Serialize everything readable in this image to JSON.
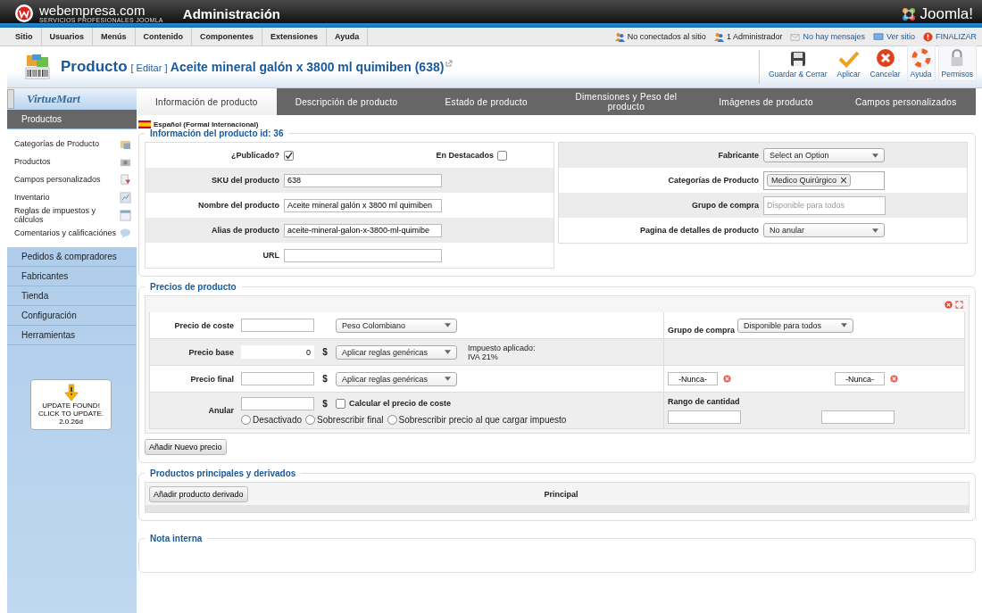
{
  "header": {
    "brand": "webempresa.com",
    "brand_tagline": "SERVICIOS PROFESIONALES JOOMLA",
    "title": "Administración",
    "cms_logo": "Joomla!"
  },
  "menu": [
    "Sitio",
    "Usuarios",
    "Menús",
    "Contenido",
    "Componentes",
    "Extensiones",
    "Ayuda"
  ],
  "status_links": [
    {
      "kind": "users",
      "label": "No conectados al sitio"
    },
    {
      "kind": "users",
      "label": "1 Administrador"
    },
    {
      "kind": "mail",
      "label": "No hay mensajes"
    },
    {
      "kind": "screen",
      "label": "Ver sitio"
    },
    {
      "kind": "power",
      "label": "FINALIZAR"
    }
  ],
  "page_title": {
    "section": "Producto",
    "action": "[ Editar ]",
    "name": "Aceite mineral galón x 3800 ml quimiben (638)"
  },
  "toolbar": [
    {
      "kind": "save",
      "label": "Guardar & Cerrar"
    },
    {
      "kind": "apply",
      "label": "Aplicar"
    },
    {
      "kind": "cancel",
      "label": "Cancelar"
    },
    {
      "kind": "help",
      "label": "Ayuda"
    },
    {
      "kind": "lock",
      "label": "Permisos"
    }
  ],
  "sidebar": {
    "logo": "VirtueMart",
    "active_group": "Productos",
    "items": [
      {
        "label": "Categorías de Producto",
        "kind": "folder"
      },
      {
        "label": "Productos",
        "kind": "camera"
      },
      {
        "label": "Campos personalizados",
        "kind": "doc"
      },
      {
        "label": "Inventario",
        "kind": "chart"
      },
      {
        "label": "Reglas de impuestos y cálculos",
        "kind": "calc"
      },
      {
        "label": "Comentarios y calificaciónes",
        "kind": "bubble"
      }
    ],
    "groups": [
      "Pedidos & compradores",
      "Fabricantes",
      "Tienda",
      "Configuración",
      "Herramientas"
    ],
    "update": {
      "lines": [
        "UPDATE FOUND!",
        "CLICK TO UPDATE.",
        "2.0.26d"
      ]
    }
  },
  "tabs": [
    {
      "label": "Información de producto",
      "selected": true
    },
    {
      "label": "Descripción de producto",
      "selected": false
    },
    {
      "label": "Estado de producto",
      "selected": false
    },
    {
      "label": "Dimensiones y Peso del producto",
      "selected": false
    },
    {
      "label": "Imágenes de producto",
      "selected": false
    },
    {
      "label": "Campos personalizados",
      "selected": false
    }
  ],
  "language": "Español (Formal Internacional)",
  "info": {
    "legend": "Información del producto id: 36",
    "published": {
      "label": "¿Publicado?",
      "checked": true
    },
    "featured": {
      "label": "En Destacados",
      "checked": false
    },
    "left_fields": [
      {
        "label": "SKU del producto",
        "value": "638"
      },
      {
        "label": "Nombre del producto",
        "value": "Aceite mineral galón x 3800 ml quimiben"
      },
      {
        "label": "Alias de producto",
        "value": "aceite-mineral-galon-x-3800-ml-quimibe"
      },
      {
        "label": "URL"
      }
    ],
    "right_fields": [
      {
        "kind": "select",
        "label": "Fabricante",
        "value": "Select an Option"
      },
      {
        "kind": "tags",
        "label": "Categorías de Producto",
        "value": "Medico Quirúrgico"
      },
      {
        "kind": "input",
        "label": "Grupo de compra",
        "placeholder": "Disponible para todos"
      },
      {
        "kind": "select",
        "label": "Pagina de detalles de producto",
        "value": "No anular"
      }
    ]
  },
  "prices": {
    "legend": "Precios de producto",
    "cost": {
      "label": "Precio de coste",
      "currency": "Peso Colombiano"
    },
    "shopper_group": {
      "label": "Grupo de compra",
      "value": "Disponible para todos"
    },
    "base": {
      "label": "Precio base",
      "value": "0",
      "unit": "$",
      "rule": "Aplicar reglas genéricas",
      "tax_label": "Impuesto aplicado:",
      "tax_value": "IVA 21%"
    },
    "final": {
      "label": "Precio final",
      "unit": "$",
      "rule": "Aplicar reglas genéricas",
      "date_from": "-Nunca-",
      "date_to": "-Nunca-"
    },
    "override": {
      "label": "Anular",
      "unit": "$",
      "calc_label": "Calcular el precio de coste",
      "calc_checked": false,
      "options": [
        {
          "label": "Desactivado",
          "selected": false
        },
        {
          "label": "Sobrescribir final",
          "selected": false
        },
        {
          "label": "Sobrescribir precio al que cargar impuesto",
          "selected": false
        }
      ],
      "range_label": "Rango de cantidad"
    },
    "add_button": "Añadir Nuevo precio"
  },
  "related": {
    "legend": "Productos principales y derivados",
    "add_button": "Añadir producto derivado",
    "column": "Principal"
  },
  "note": {
    "legend": "Nota interna"
  }
}
